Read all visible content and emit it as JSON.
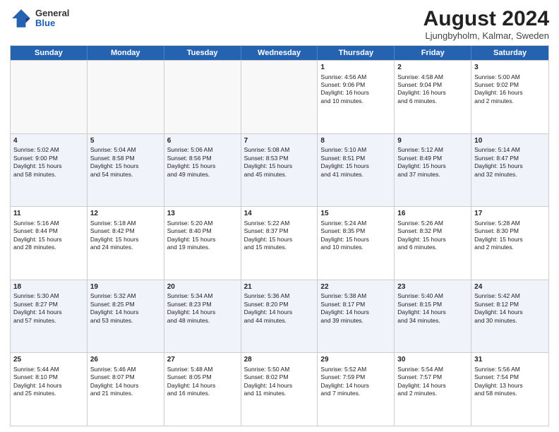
{
  "header": {
    "logo": {
      "general": "General",
      "blue": "Blue"
    },
    "month_year": "August 2024",
    "location": "Ljungbyholm, Kalmar, Sweden"
  },
  "days_of_week": [
    "Sunday",
    "Monday",
    "Tuesday",
    "Wednesday",
    "Thursday",
    "Friday",
    "Saturday"
  ],
  "weeks": [
    [
      {
        "day": "",
        "data": "",
        "empty": true
      },
      {
        "day": "",
        "data": "",
        "empty": true
      },
      {
        "day": "",
        "data": "",
        "empty": true
      },
      {
        "day": "",
        "data": "",
        "empty": true
      },
      {
        "day": "1",
        "data": "Sunrise: 4:56 AM\nSunset: 9:06 PM\nDaylight: 16 hours\nand 10 minutes."
      },
      {
        "day": "2",
        "data": "Sunrise: 4:58 AM\nSunset: 9:04 PM\nDaylight: 16 hours\nand 6 minutes."
      },
      {
        "day": "3",
        "data": "Sunrise: 5:00 AM\nSunset: 9:02 PM\nDaylight: 16 hours\nand 2 minutes."
      }
    ],
    [
      {
        "day": "4",
        "data": "Sunrise: 5:02 AM\nSunset: 9:00 PM\nDaylight: 15 hours\nand 58 minutes."
      },
      {
        "day": "5",
        "data": "Sunrise: 5:04 AM\nSunset: 8:58 PM\nDaylight: 15 hours\nand 54 minutes."
      },
      {
        "day": "6",
        "data": "Sunrise: 5:06 AM\nSunset: 8:56 PM\nDaylight: 15 hours\nand 49 minutes."
      },
      {
        "day": "7",
        "data": "Sunrise: 5:08 AM\nSunset: 8:53 PM\nDaylight: 15 hours\nand 45 minutes."
      },
      {
        "day": "8",
        "data": "Sunrise: 5:10 AM\nSunset: 8:51 PM\nDaylight: 15 hours\nand 41 minutes."
      },
      {
        "day": "9",
        "data": "Sunrise: 5:12 AM\nSunset: 8:49 PM\nDaylight: 15 hours\nand 37 minutes."
      },
      {
        "day": "10",
        "data": "Sunrise: 5:14 AM\nSunset: 8:47 PM\nDaylight: 15 hours\nand 32 minutes."
      }
    ],
    [
      {
        "day": "11",
        "data": "Sunrise: 5:16 AM\nSunset: 8:44 PM\nDaylight: 15 hours\nand 28 minutes."
      },
      {
        "day": "12",
        "data": "Sunrise: 5:18 AM\nSunset: 8:42 PM\nDaylight: 15 hours\nand 24 minutes."
      },
      {
        "day": "13",
        "data": "Sunrise: 5:20 AM\nSunset: 8:40 PM\nDaylight: 15 hours\nand 19 minutes."
      },
      {
        "day": "14",
        "data": "Sunrise: 5:22 AM\nSunset: 8:37 PM\nDaylight: 15 hours\nand 15 minutes."
      },
      {
        "day": "15",
        "data": "Sunrise: 5:24 AM\nSunset: 8:35 PM\nDaylight: 15 hours\nand 10 minutes."
      },
      {
        "day": "16",
        "data": "Sunrise: 5:26 AM\nSunset: 8:32 PM\nDaylight: 15 hours\nand 6 minutes."
      },
      {
        "day": "17",
        "data": "Sunrise: 5:28 AM\nSunset: 8:30 PM\nDaylight: 15 hours\nand 2 minutes."
      }
    ],
    [
      {
        "day": "18",
        "data": "Sunrise: 5:30 AM\nSunset: 8:27 PM\nDaylight: 14 hours\nand 57 minutes."
      },
      {
        "day": "19",
        "data": "Sunrise: 5:32 AM\nSunset: 8:25 PM\nDaylight: 14 hours\nand 53 minutes."
      },
      {
        "day": "20",
        "data": "Sunrise: 5:34 AM\nSunset: 8:23 PM\nDaylight: 14 hours\nand 48 minutes."
      },
      {
        "day": "21",
        "data": "Sunrise: 5:36 AM\nSunset: 8:20 PM\nDaylight: 14 hours\nand 44 minutes."
      },
      {
        "day": "22",
        "data": "Sunrise: 5:38 AM\nSunset: 8:17 PM\nDaylight: 14 hours\nand 39 minutes."
      },
      {
        "day": "23",
        "data": "Sunrise: 5:40 AM\nSunset: 8:15 PM\nDaylight: 14 hours\nand 34 minutes."
      },
      {
        "day": "24",
        "data": "Sunrise: 5:42 AM\nSunset: 8:12 PM\nDaylight: 14 hours\nand 30 minutes."
      }
    ],
    [
      {
        "day": "25",
        "data": "Sunrise: 5:44 AM\nSunset: 8:10 PM\nDaylight: 14 hours\nand 25 minutes."
      },
      {
        "day": "26",
        "data": "Sunrise: 5:46 AM\nSunset: 8:07 PM\nDaylight: 14 hours\nand 21 minutes."
      },
      {
        "day": "27",
        "data": "Sunrise: 5:48 AM\nSunset: 8:05 PM\nDaylight: 14 hours\nand 16 minutes."
      },
      {
        "day": "28",
        "data": "Sunrise: 5:50 AM\nSunset: 8:02 PM\nDaylight: 14 hours\nand 11 minutes."
      },
      {
        "day": "29",
        "data": "Sunrise: 5:52 AM\nSunset: 7:59 PM\nDaylight: 14 hours\nand 7 minutes."
      },
      {
        "day": "30",
        "data": "Sunrise: 5:54 AM\nSunset: 7:57 PM\nDaylight: 14 hours\nand 2 minutes."
      },
      {
        "day": "31",
        "data": "Sunrise: 5:56 AM\nSunset: 7:54 PM\nDaylight: 13 hours\nand 58 minutes."
      }
    ]
  ]
}
